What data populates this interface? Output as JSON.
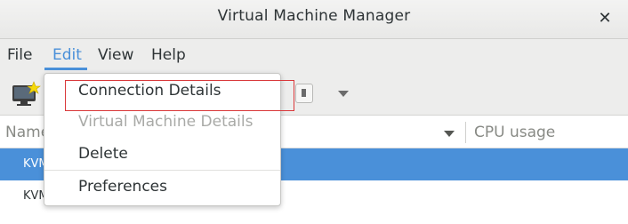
{
  "window": {
    "title": "Virtual Machine Manager",
    "close_glyph": "✕"
  },
  "menubar": {
    "items": [
      {
        "label": "File"
      },
      {
        "label": "Edit",
        "active": true
      },
      {
        "label": "View"
      },
      {
        "label": "Help"
      }
    ]
  },
  "toolbar": {
    "buttons": [
      {
        "icon": "new-vm-icon"
      },
      {
        "icon": "stop-square-icon"
      },
      {
        "icon": "chevron-down-icon"
      }
    ]
  },
  "table": {
    "columns": [
      {
        "label": "Name"
      },
      {
        "label": "CPU usage"
      }
    ],
    "rows": [
      {
        "label": "KVM",
        "selected": true
      },
      {
        "label": "KVM",
        "selected": false
      }
    ]
  },
  "edit_menu": {
    "items": [
      {
        "label": "Connection Details",
        "enabled": true
      },
      {
        "label": "Virtual Machine Details",
        "enabled": false
      },
      {
        "label": "Delete",
        "enabled": true
      },
      {
        "label": "Preferences",
        "enabled": true
      }
    ]
  },
  "colors": {
    "accent": "#4a90d9",
    "highlight_outline": "#d9383a",
    "disabled_text": "#a9aaa7"
  }
}
